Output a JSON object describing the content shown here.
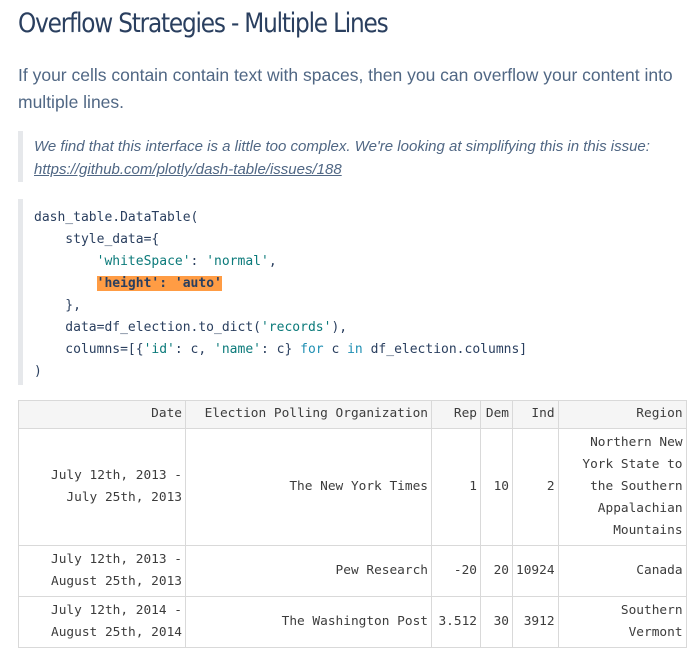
{
  "page": {
    "title": "Overflow Strategies - Multiple Lines",
    "intro": "If your cells contain contain text with spaces, then you can overflow your content into multiple lines."
  },
  "note": {
    "text": "We find that this interface is a little too complex. We're looking at simplifying this in this issue: ",
    "link": "https://github.com/plotly/dash-table/issues/188"
  },
  "code": {
    "line1": "dash_table.DataTable(",
    "line2": "    style_data={",
    "line3_key": "'whiteSpace'",
    "line3_sep": ": ",
    "line3_val": "'normal'",
    "line3_end": ",",
    "line4": "'height': 'auto'",
    "line5": "    },",
    "line6_a": "    data=df_election.to_dict(",
    "line6_str": "'records'",
    "line6_b": "),",
    "line7_a": "    columns=[{",
    "line7_id": "'id'",
    "line7_b": ": c, ",
    "line7_name": "'name'",
    "line7_c": ": c} ",
    "line7_for": "for",
    "line7_d": " c ",
    "line7_in": "in",
    "line7_e": " df_election.columns]",
    "line8": ")"
  },
  "table": {
    "columns": [
      "Date",
      "Election Polling Organization",
      "Rep",
      "Dem",
      "Ind",
      "Region"
    ],
    "rows": [
      [
        "July 12th, 2013 - July 25th, 2013",
        "The New York Times",
        "1",
        "10",
        "2",
        "Northern New York State to the Southern Appalachian Mountains"
      ],
      [
        "July 12th, 2013 - August 25th, 2013",
        "Pew Research",
        "-20",
        "20",
        "10924",
        "Canada"
      ],
      [
        "July 12th, 2014 - August 25th, 2014",
        "The Washington Post",
        "3.512",
        "30",
        "3912",
        "Southern Vermont"
      ]
    ]
  }
}
